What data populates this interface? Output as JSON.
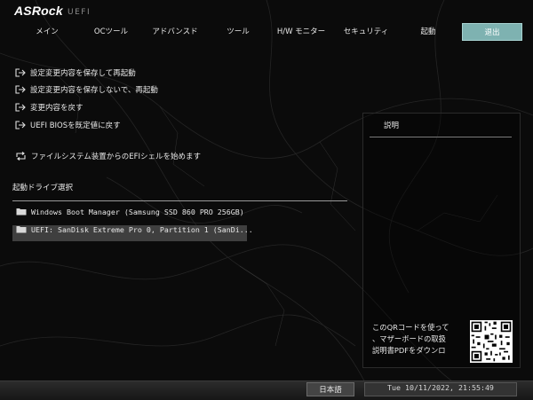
{
  "header": {
    "brand": "ASRock",
    "subtitle": "UEFI"
  },
  "tabs": [
    {
      "label": "メイン"
    },
    {
      "label": "OCツール"
    },
    {
      "label": "アドバンスド"
    },
    {
      "label": "ツール"
    },
    {
      "label": "H/W モニター"
    },
    {
      "label": "セキュリティ"
    },
    {
      "label": "起動"
    },
    {
      "label": "退出",
      "active": true
    }
  ],
  "menu": {
    "save_reset": "設定変更内容を保存して再起動",
    "discard_reset": "設定変更内容を保存しないで、再起動",
    "discard": "変更内容を戻す",
    "load_defaults": "UEFI BIOSを既定値に戻す",
    "efi_shell": "ファイルシステム装置からのEFIシェルを始めます"
  },
  "boot_override": {
    "title": "起動ドライブ選択",
    "items": [
      {
        "label": "Windows Boot Manager (Samsung SSD 860 PRO 256GB)",
        "selected": false
      },
      {
        "label": "UEFI: SanDisk Extreme Pro 0, Partition 1 (SanDi...",
        "selected": true
      }
    ]
  },
  "description": {
    "title": "説明",
    "qr_lines": [
      "このQRコードを使って",
      "、マザーボードの取扱",
      "説明書PDFをダウンロ"
    ]
  },
  "footer": {
    "language": "日本語",
    "datetime": "Tue 10/11/2022, 21:55:49"
  },
  "colors": {
    "accent": "#7eb2b1",
    "selected_row": "#3f3f3f",
    "footer": "#222222"
  },
  "icons": {
    "menu": "exit-arrow-icon",
    "efi_shell": "refresh-arrows-icon",
    "boot": "folder-icon"
  }
}
